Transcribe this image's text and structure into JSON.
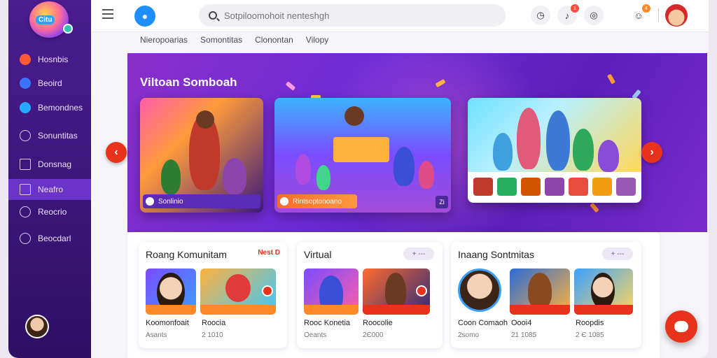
{
  "sidebar": {
    "logo_text": "Citu",
    "items": [
      {
        "label": "Hosnbis"
      },
      {
        "label": "Beoird"
      },
      {
        "label": "Bemondnes"
      },
      {
        "label": "Sonuntitas"
      },
      {
        "label": "Donsnag"
      },
      {
        "label": "Neafro"
      },
      {
        "label": "Reocrio"
      },
      {
        "label": "Beocdarl"
      }
    ]
  },
  "topbar": {
    "search_placeholder": "Sotpiloomohoit nenteshgh",
    "badge_1": "1",
    "badge_2": "4"
  },
  "tabs": [
    "Nieropoarias",
    "Somontitas",
    "Clonontan",
    "Vilopy"
  ],
  "hero": {
    "title": "Viltoan Somboah",
    "card1_caption": "Sonlinio",
    "card2_caption": "Rintsoptonoano",
    "card2_corner": "Zi"
  },
  "sections": [
    {
      "title": "Roang Komunitam",
      "link": "Nest D",
      "items": [
        {
          "name": "Koomonfoait",
          "sub": "Asants"
        },
        {
          "name": "Roocia",
          "sub": "2 1010"
        }
      ]
    },
    {
      "title": "Virtual",
      "pill": "+ ---",
      "items": [
        {
          "name": "Rooc Konetia",
          "sub": "Oeants"
        },
        {
          "name": "Roocolie",
          "sub": "2Є000"
        }
      ]
    },
    {
      "title": "Inaang Sontmitas",
      "pill": "+ ---",
      "items": [
        {
          "name": "Coon Comaoh",
          "sub": "2somo"
        },
        {
          "name": "Oooi4",
          "sub": "21 1085"
        },
        {
          "name": "Roopdis",
          "sub": "2 Є 1085"
        }
      ]
    }
  ]
}
